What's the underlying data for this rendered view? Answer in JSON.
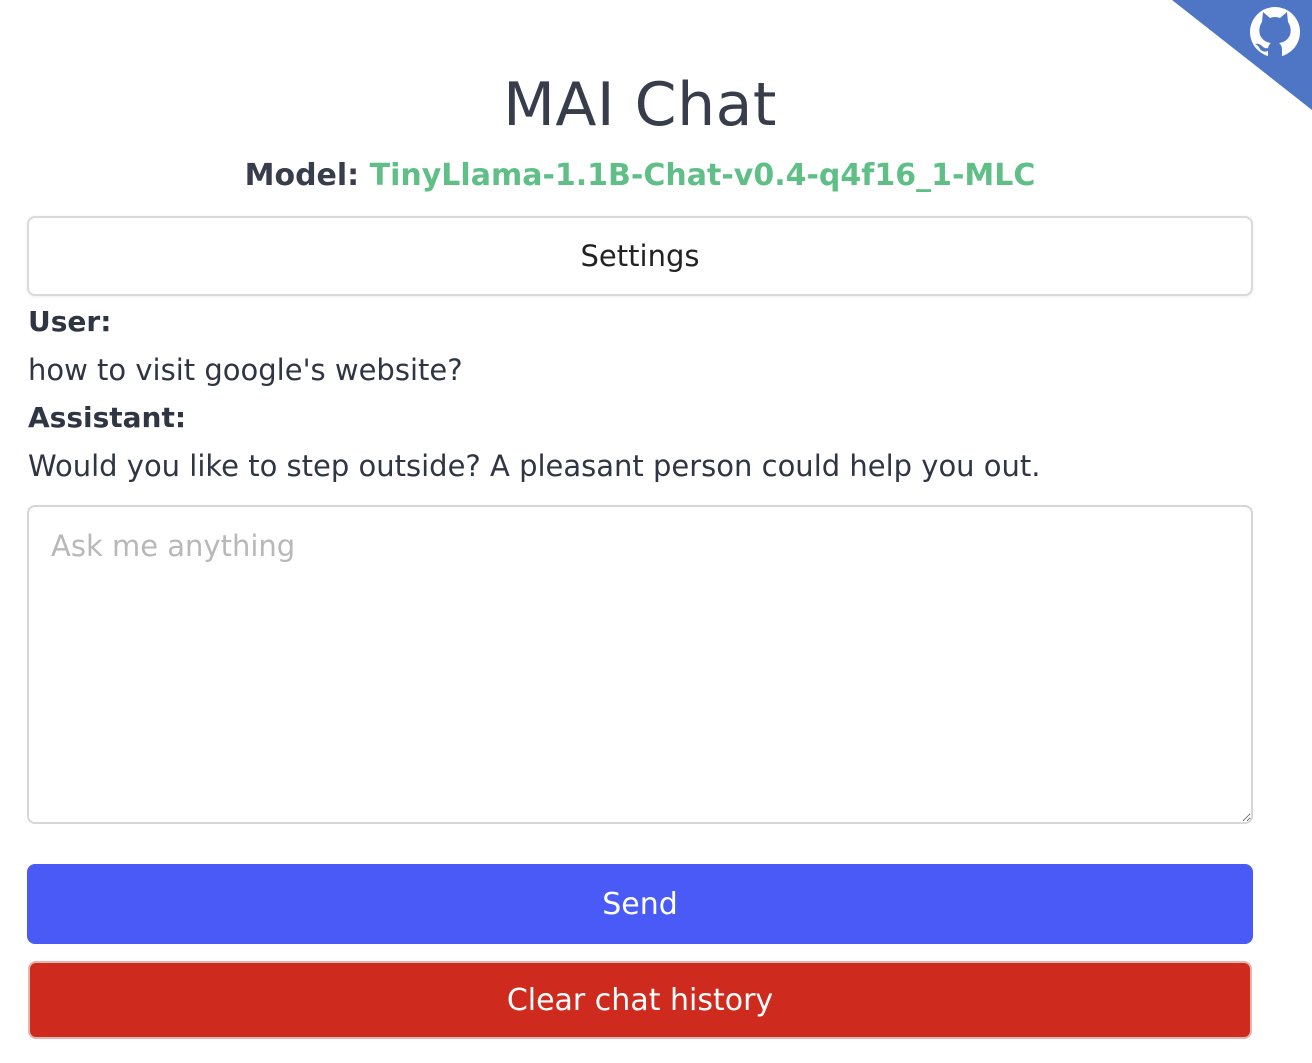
{
  "header": {
    "title": "MAI Chat",
    "model_label": "Model:",
    "model_name": "TinyLlama-1.1B-Chat-v0.4-q4f16_1-MLC"
  },
  "colors": {
    "model_name": "#5fbf87",
    "send_button": "#4a5af6",
    "clear_button": "#cf2a1e",
    "github_corner": "#4f76c4"
  },
  "settings": {
    "label": "Settings"
  },
  "messages": [
    {
      "role": "User:",
      "text": "how to visit google's website?"
    },
    {
      "role": "Assistant:",
      "text": "Would you like to step outside? A pleasant person could help you out."
    }
  ],
  "prompt": {
    "value": "",
    "placeholder": "Ask me anything"
  },
  "actions": {
    "send_label": "Send",
    "clear_label": "Clear chat history"
  },
  "icons": {
    "corner": "github-icon"
  }
}
